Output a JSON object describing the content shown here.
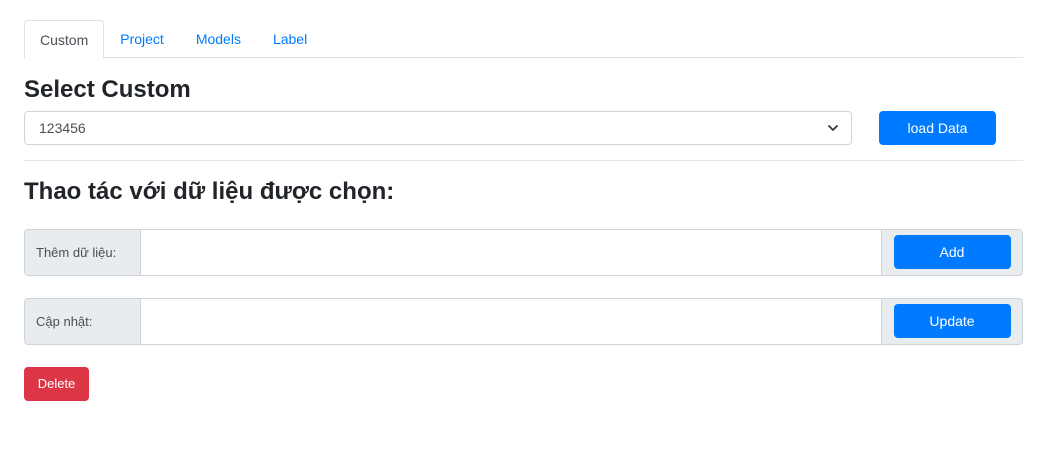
{
  "tabs": [
    {
      "label": "Custom",
      "active": true
    },
    {
      "label": "Project",
      "active": false
    },
    {
      "label": "Models",
      "active": false
    },
    {
      "label": "Label",
      "active": false
    }
  ],
  "select_section": {
    "title": "Select Custom",
    "selected_value": "123456",
    "load_button": "load Data"
  },
  "data_section": {
    "title": "Thao tác với dữ liệu được chọn:",
    "add_row": {
      "label": "Thêm dữ liệu:",
      "value": "",
      "button": "Add"
    },
    "update_row": {
      "label": "Cập nhật:",
      "value": "",
      "button": "Update"
    },
    "delete_button": "Delete"
  },
  "colors": {
    "primary": "#007bff",
    "danger": "#dc3545",
    "addon_bg": "#e9ecef",
    "tab_link": "#007bff"
  },
  "icons": {
    "select_arrow": "chevron-down-icon"
  }
}
